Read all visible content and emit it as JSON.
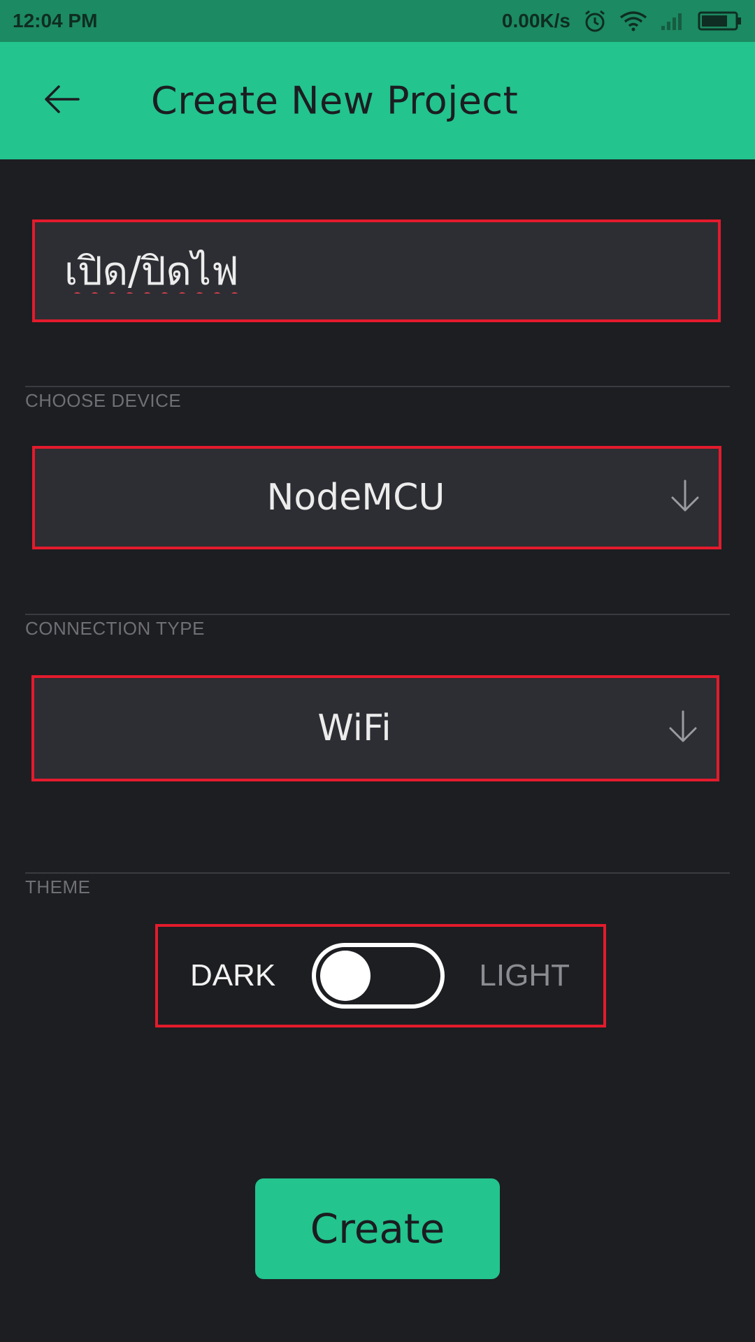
{
  "status_bar": {
    "time": "12:04 PM",
    "network_speed": "0.00K/s",
    "icons": [
      "alarm-icon",
      "wifi-icon",
      "signal-icon",
      "battery-icon"
    ]
  },
  "app_bar": {
    "title": "Create New Project",
    "back_icon": "arrow-left-icon"
  },
  "project_name": {
    "value": "เปิด/ปิดไฟ"
  },
  "choose_device": {
    "label": "CHOOSE DEVICE",
    "selected": "NodeMCU",
    "icon": "arrow-down-icon"
  },
  "connection_type": {
    "label": "CONNECTION TYPE",
    "selected": "WiFi",
    "icon": "arrow-down-icon"
  },
  "theme": {
    "label": "THEME",
    "dark_label": "DARK",
    "light_label": "LIGHT",
    "selected": "DARK"
  },
  "create_button": {
    "label": "Create"
  },
  "colors": {
    "accent": "#23c48e",
    "background": "#1d1e22",
    "field_background": "#2d2e33",
    "highlight_border": "#e31b2c"
  }
}
